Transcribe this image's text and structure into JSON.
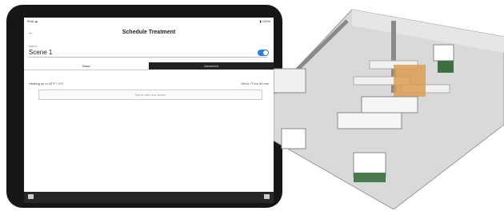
{
  "statusbar": {
    "carrier": "iPad ☁",
    "battery": "▮ 100%"
  },
  "navbar": {
    "back_label": "←",
    "title": "Schedule Treatment"
  },
  "form": {
    "field_label": "Name",
    "field_value": "Scene 1"
  },
  "segments": [
    "Basic",
    "Advanced"
  ],
  "row": {
    "left": "Heating up to 40°F / 4°C",
    "right": "Set to 72 for 30 min"
  },
  "placeholder": "Tap to add new action",
  "colors": {
    "toggle": "#2a7de1",
    "bezel": "#161616",
    "bottom_bar": "#272727"
  },
  "icons": [
    "back-icon",
    "toggle-switch-icon",
    "home-icon",
    "settings-icon"
  ]
}
